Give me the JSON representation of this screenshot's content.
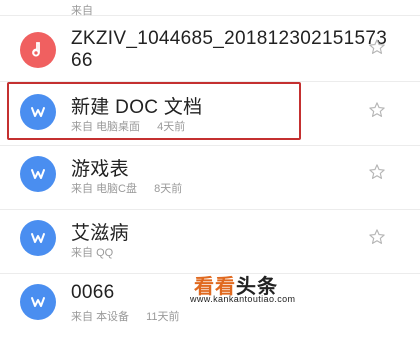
{
  "files": [
    {
      "title": "",
      "source": "来自",
      "device": "",
      "time": "",
      "avatar_color": "#f06060",
      "icon": "music-note-icon"
    },
    {
      "title_line1": "ZKZIV_1044685_201812302151573",
      "title_line2": "66",
      "avatar_color": "#f06060",
      "icon": "music-note-icon"
    },
    {
      "title": "新建 DOC 文档",
      "source": "来自",
      "device": "电脑桌面",
      "time": "4天前",
      "avatar_color": "#4a8ef0",
      "icon": "word-doc-icon"
    },
    {
      "title": "游戏表",
      "source": "来自",
      "device": "电脑C盘",
      "time": "8天前",
      "avatar_color": "#4a8ef0",
      "icon": "word-doc-icon"
    },
    {
      "title": "艾滋病",
      "source": "来自",
      "device": "QQ",
      "time": "",
      "avatar_color": "#4a8ef0",
      "icon": "word-doc-icon"
    },
    {
      "title": "0066",
      "source": "来自",
      "device": "本设备",
      "time": "11天前",
      "avatar_color": "#4a8ef0",
      "icon": "word-doc-icon"
    }
  ],
  "watermark": {
    "brand_a": "看看",
    "brand_b": "头条",
    "url": "www.kankantoutiao.com"
  },
  "colors": {
    "highlight": "#c43030",
    "doc_blue": "#4a8ef0",
    "audio_red": "#f06060"
  }
}
